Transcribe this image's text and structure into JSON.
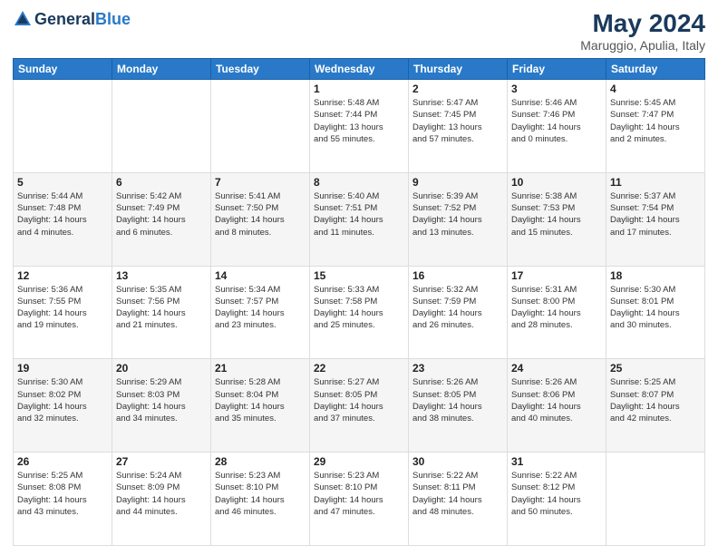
{
  "header": {
    "logo": "General Blue",
    "title": "May 2024",
    "subtitle": "Maruggio, Apulia, Italy"
  },
  "weekdays": [
    "Sunday",
    "Monday",
    "Tuesday",
    "Wednesday",
    "Thursday",
    "Friday",
    "Saturday"
  ],
  "weeks": [
    [
      {
        "day": "",
        "info": ""
      },
      {
        "day": "",
        "info": ""
      },
      {
        "day": "",
        "info": ""
      },
      {
        "day": "1",
        "info": "Sunrise: 5:48 AM\nSunset: 7:44 PM\nDaylight: 13 hours\nand 55 minutes."
      },
      {
        "day": "2",
        "info": "Sunrise: 5:47 AM\nSunset: 7:45 PM\nDaylight: 13 hours\nand 57 minutes."
      },
      {
        "day": "3",
        "info": "Sunrise: 5:46 AM\nSunset: 7:46 PM\nDaylight: 14 hours\nand 0 minutes."
      },
      {
        "day": "4",
        "info": "Sunrise: 5:45 AM\nSunset: 7:47 PM\nDaylight: 14 hours\nand 2 minutes."
      }
    ],
    [
      {
        "day": "5",
        "info": "Sunrise: 5:44 AM\nSunset: 7:48 PM\nDaylight: 14 hours\nand 4 minutes."
      },
      {
        "day": "6",
        "info": "Sunrise: 5:42 AM\nSunset: 7:49 PM\nDaylight: 14 hours\nand 6 minutes."
      },
      {
        "day": "7",
        "info": "Sunrise: 5:41 AM\nSunset: 7:50 PM\nDaylight: 14 hours\nand 8 minutes."
      },
      {
        "day": "8",
        "info": "Sunrise: 5:40 AM\nSunset: 7:51 PM\nDaylight: 14 hours\nand 11 minutes."
      },
      {
        "day": "9",
        "info": "Sunrise: 5:39 AM\nSunset: 7:52 PM\nDaylight: 14 hours\nand 13 minutes."
      },
      {
        "day": "10",
        "info": "Sunrise: 5:38 AM\nSunset: 7:53 PM\nDaylight: 14 hours\nand 15 minutes."
      },
      {
        "day": "11",
        "info": "Sunrise: 5:37 AM\nSunset: 7:54 PM\nDaylight: 14 hours\nand 17 minutes."
      }
    ],
    [
      {
        "day": "12",
        "info": "Sunrise: 5:36 AM\nSunset: 7:55 PM\nDaylight: 14 hours\nand 19 minutes."
      },
      {
        "day": "13",
        "info": "Sunrise: 5:35 AM\nSunset: 7:56 PM\nDaylight: 14 hours\nand 21 minutes."
      },
      {
        "day": "14",
        "info": "Sunrise: 5:34 AM\nSunset: 7:57 PM\nDaylight: 14 hours\nand 23 minutes."
      },
      {
        "day": "15",
        "info": "Sunrise: 5:33 AM\nSunset: 7:58 PM\nDaylight: 14 hours\nand 25 minutes."
      },
      {
        "day": "16",
        "info": "Sunrise: 5:32 AM\nSunset: 7:59 PM\nDaylight: 14 hours\nand 26 minutes."
      },
      {
        "day": "17",
        "info": "Sunrise: 5:31 AM\nSunset: 8:00 PM\nDaylight: 14 hours\nand 28 minutes."
      },
      {
        "day": "18",
        "info": "Sunrise: 5:30 AM\nSunset: 8:01 PM\nDaylight: 14 hours\nand 30 minutes."
      }
    ],
    [
      {
        "day": "19",
        "info": "Sunrise: 5:30 AM\nSunset: 8:02 PM\nDaylight: 14 hours\nand 32 minutes."
      },
      {
        "day": "20",
        "info": "Sunrise: 5:29 AM\nSunset: 8:03 PM\nDaylight: 14 hours\nand 34 minutes."
      },
      {
        "day": "21",
        "info": "Sunrise: 5:28 AM\nSunset: 8:04 PM\nDaylight: 14 hours\nand 35 minutes."
      },
      {
        "day": "22",
        "info": "Sunrise: 5:27 AM\nSunset: 8:05 PM\nDaylight: 14 hours\nand 37 minutes."
      },
      {
        "day": "23",
        "info": "Sunrise: 5:26 AM\nSunset: 8:05 PM\nDaylight: 14 hours\nand 38 minutes."
      },
      {
        "day": "24",
        "info": "Sunrise: 5:26 AM\nSunset: 8:06 PM\nDaylight: 14 hours\nand 40 minutes."
      },
      {
        "day": "25",
        "info": "Sunrise: 5:25 AM\nSunset: 8:07 PM\nDaylight: 14 hours\nand 42 minutes."
      }
    ],
    [
      {
        "day": "26",
        "info": "Sunrise: 5:25 AM\nSunset: 8:08 PM\nDaylight: 14 hours\nand 43 minutes."
      },
      {
        "day": "27",
        "info": "Sunrise: 5:24 AM\nSunset: 8:09 PM\nDaylight: 14 hours\nand 44 minutes."
      },
      {
        "day": "28",
        "info": "Sunrise: 5:23 AM\nSunset: 8:10 PM\nDaylight: 14 hours\nand 46 minutes."
      },
      {
        "day": "29",
        "info": "Sunrise: 5:23 AM\nSunset: 8:10 PM\nDaylight: 14 hours\nand 47 minutes."
      },
      {
        "day": "30",
        "info": "Sunrise: 5:22 AM\nSunset: 8:11 PM\nDaylight: 14 hours\nand 48 minutes."
      },
      {
        "day": "31",
        "info": "Sunrise: 5:22 AM\nSunset: 8:12 PM\nDaylight: 14 hours\nand 50 minutes."
      },
      {
        "day": "",
        "info": ""
      }
    ]
  ]
}
